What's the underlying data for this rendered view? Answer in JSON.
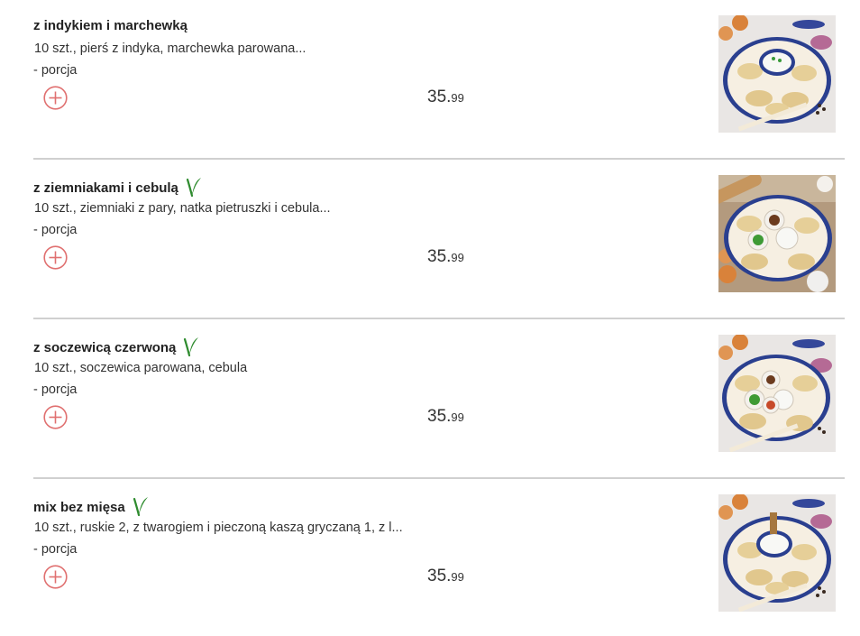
{
  "menu": {
    "items": [
      {
        "title": "z indykiem i marchewką",
        "vegetarian": false,
        "description": "10 szt., pierś z indyka, marchewka parowana...",
        "variant": "- porcja",
        "price_main": "35.",
        "price_cents": "99",
        "image_icon": "dumplings-plate-sauce-image"
      },
      {
        "title": "z ziemniakami i cebulą",
        "vegetarian": true,
        "description": "10 szt., ziemniaki z pary, natka pietruszki i cebula...",
        "variant": "- porcja",
        "price_main": "35.",
        "price_cents": "99",
        "image_icon": "dumplings-plate-toppings-image"
      },
      {
        "title": "z soczewicą czerwoną",
        "vegetarian": true,
        "description": "10 szt., soczewica parowana, cebula",
        "variant": "- porcja",
        "price_main": "35.",
        "price_cents": "99",
        "image_icon": "dumplings-plate-toppings-image"
      },
      {
        "title": "mix bez mięsa",
        "vegetarian": true,
        "description": "10 szt., ruskie 2, z twarogiem i pieczoną kaszą gryczaną 1, z l...",
        "variant": "- porcja",
        "price_main": "35.",
        "price_cents": "99",
        "image_icon": "dumplings-plate-sauce-image"
      }
    ]
  },
  "colors": {
    "add_button": "#e07070",
    "vegetarian_leaf": "#2e8b2e",
    "divider": "#d0d0d0",
    "plate_rim": "#2a3f8f"
  }
}
